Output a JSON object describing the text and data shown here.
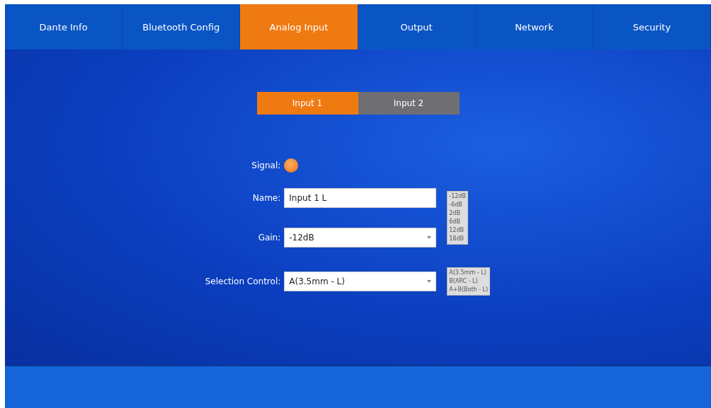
{
  "tabs": [
    {
      "label": "Dante Info",
      "selected": false
    },
    {
      "label": "Bluetooth Config",
      "selected": false
    },
    {
      "label": "Analog Input",
      "selected": true
    },
    {
      "label": "Output",
      "selected": false
    },
    {
      "label": "Network",
      "selected": false
    },
    {
      "label": "Security",
      "selected": false
    }
  ],
  "input_tabs": [
    {
      "label": "Input 1",
      "selected": true
    },
    {
      "label": "Input 2",
      "selected": false
    }
  ],
  "signal": {
    "label": "Signal:",
    "on": true
  },
  "name": {
    "label": "Name:",
    "value": "Input 1 L"
  },
  "gain": {
    "label": "Gain:",
    "value": "-12dB",
    "options": [
      "-12dB",
      "-6dB",
      "2dB",
      "6dB",
      "12dB",
      "18dB"
    ]
  },
  "selection_control": {
    "label": "Selection Control:",
    "value": "A(3.5mm - L)",
    "options": [
      "A(3.5mm - L)",
      "B(ARC - L)",
      "A+B(Both - L)"
    ]
  }
}
